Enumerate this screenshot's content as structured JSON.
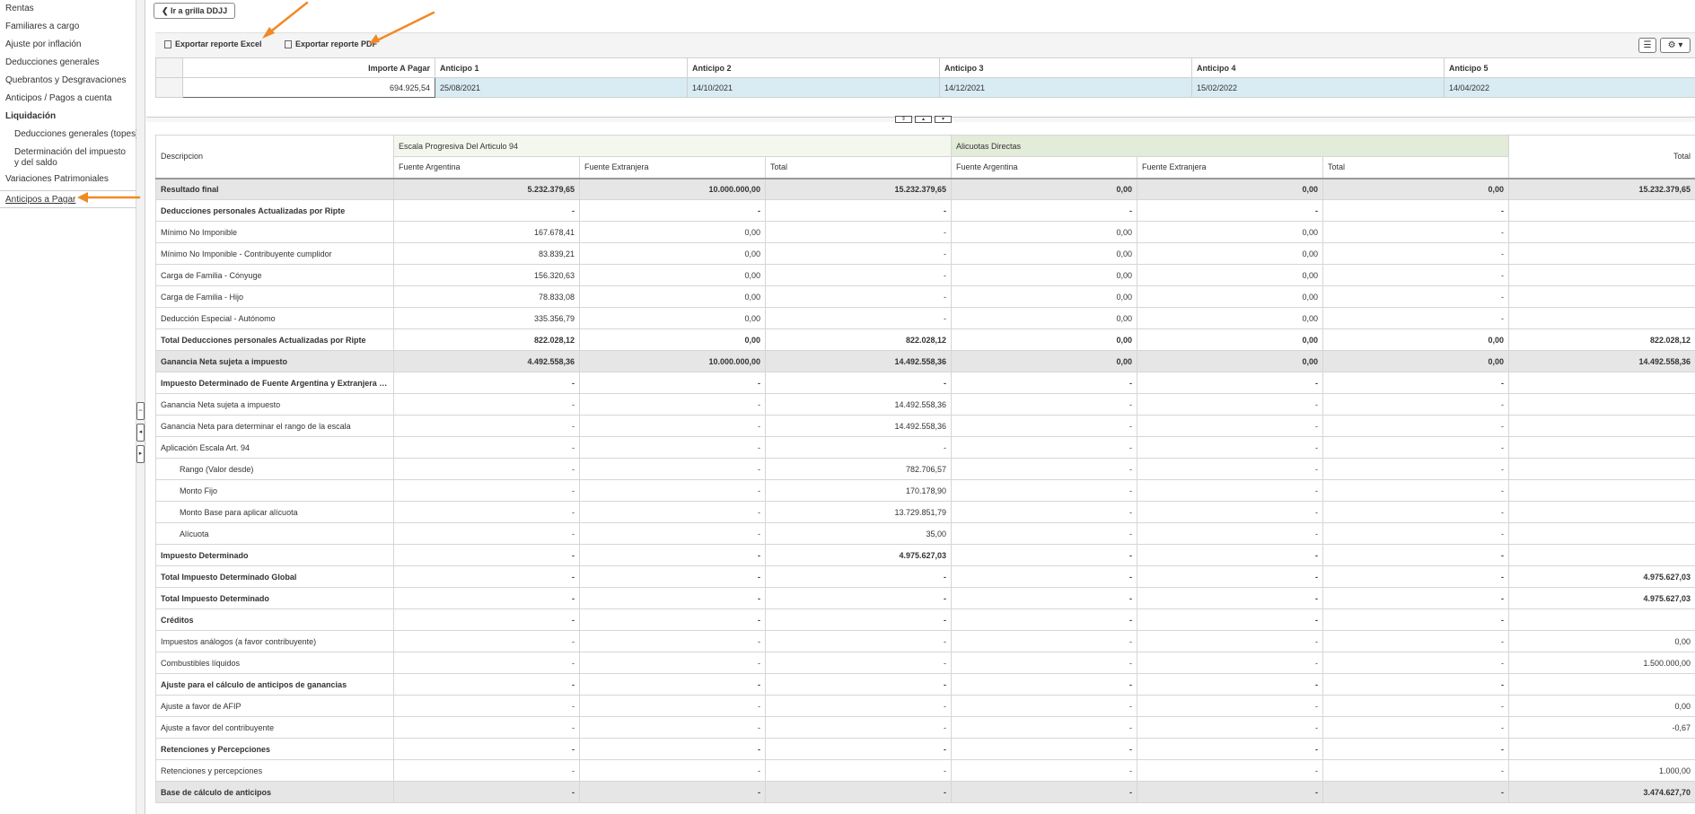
{
  "sidebar": {
    "items": [
      {
        "label": "Rentas",
        "style": ""
      },
      {
        "label": "Familiares a cargo",
        "style": ""
      },
      {
        "label": "Ajuste por inflación",
        "style": ""
      },
      {
        "label": "Deducciones generales",
        "style": ""
      },
      {
        "label": "Quebrantos y Desgravaciones",
        "style": ""
      },
      {
        "label": "Anticipos / Pagos a cuenta",
        "style": ""
      },
      {
        "label": "Liquidación",
        "style": "bold"
      },
      {
        "label": "Deducciones generales (topes)",
        "style": "sub"
      },
      {
        "label": "Determinación del impuesto y del saldo",
        "style": "sub2"
      },
      {
        "label": "Variaciones Patrimoniales",
        "style": ""
      },
      {
        "label": "Anticipos a Pagar",
        "style": "active"
      }
    ]
  },
  "splitter": {
    "buttons": [
      "⇔",
      "◂",
      "▸"
    ]
  },
  "header": {
    "back_label": "❮  Ir a grilla DDJJ"
  },
  "toolbar": {
    "excel_label": "Exportar reporte Excel",
    "pdf_label": "Exportar reporte PDF",
    "menu_icon": "☰",
    "settings_icon": "⚙ ▾"
  },
  "advances": {
    "headers": [
      "Importe A Pagar",
      "Anticipo 1",
      "Anticipo 2",
      "Anticipo 3",
      "Anticipo 4",
      "Anticipo 5"
    ],
    "values": [
      "694.925,54",
      "25/08/2021",
      "14/10/2021",
      "14/12/2021",
      "15/02/2022",
      "14/04/2022"
    ]
  },
  "mid_buttons": [
    "⇕",
    "▴",
    "▾"
  ],
  "grid": {
    "desc_header": "Descripcion",
    "group1": "Escala Progresiva Del Articulo 94",
    "group2": "Alicuotas Directas",
    "total_header": "Total",
    "subheaders": [
      "Fuente Argentina",
      "Fuente Extranjera",
      "Total",
      "Fuente Argentina",
      "Fuente Extranjera",
      "Total"
    ],
    "rows": [
      {
        "d": "Resultado final",
        "s": "bold hl top-border",
        "v": [
          "5.232.379,65",
          "10.000.000,00",
          "15.232.379,65",
          "0,00",
          "0,00",
          "0,00",
          "15.232.379,65"
        ]
      },
      {
        "d": "Deducciones personales Actualizadas por Ripte",
        "s": "bold",
        "v": [
          "-",
          "-",
          "-",
          "-",
          "-",
          "-",
          ""
        ]
      },
      {
        "d": "Mínimo No Imponible",
        "s": "",
        "v": [
          "167.678,41",
          "0,00",
          "-",
          "0,00",
          "0,00",
          "-",
          ""
        ]
      },
      {
        "d": "Mínimo No Imponible - Contribuyente cumplidor",
        "s": "",
        "v": [
          "83.839,21",
          "0,00",
          "-",
          "0,00",
          "0,00",
          "-",
          ""
        ]
      },
      {
        "d": "Carga de Familia - Cónyuge",
        "s": "",
        "v": [
          "156.320,63",
          "0,00",
          "-",
          "0,00",
          "0,00",
          "-",
          ""
        ]
      },
      {
        "d": "Carga de Familia - Hijo",
        "s": "",
        "v": [
          "78.833,08",
          "0,00",
          "-",
          "0,00",
          "0,00",
          "-",
          ""
        ]
      },
      {
        "d": "Deducción Especial - Autónomo",
        "s": "",
        "v": [
          "335.356,79",
          "0,00",
          "-",
          "0,00",
          "0,00",
          "-",
          ""
        ]
      },
      {
        "d": "Total Deducciones personales Actualizadas por Ripte",
        "s": "bold",
        "v": [
          "822.028,12",
          "0,00",
          "822.028,12",
          "0,00",
          "0,00",
          "0,00",
          "822.028,12"
        ]
      },
      {
        "d": "Ganancia Neta sujeta a impuesto",
        "s": "bold hl",
        "v": [
          "4.492.558,36",
          "10.000.000,00",
          "14.492.558,36",
          "0,00",
          "0,00",
          "0,00",
          "14.492.558,36"
        ]
      },
      {
        "d": "Impuesto Determinado de Fuente Argentina y Extranjera p...",
        "s": "bold",
        "v": [
          "-",
          "-",
          "-",
          "-",
          "-",
          "-",
          ""
        ]
      },
      {
        "d": "Ganancia Neta sujeta a impuesto",
        "s": "",
        "v": [
          "-",
          "-",
          "14.492.558,36",
          "-",
          "-",
          "-",
          ""
        ]
      },
      {
        "d": "Ganancia Neta para determinar el rango de la escala",
        "s": "",
        "v": [
          "-",
          "-",
          "14.492.558,36",
          "-",
          "-",
          "-",
          ""
        ]
      },
      {
        "d": "Aplicación Escala Art. 94",
        "s": "",
        "v": [
          "-",
          "-",
          "-",
          "-",
          "-",
          "-",
          ""
        ]
      },
      {
        "d": "Rango (Valor desde)",
        "s": "ind",
        "v": [
          "-",
          "-",
          "782.706,57",
          "-",
          "-",
          "-",
          ""
        ]
      },
      {
        "d": "Monto Fijo",
        "s": "ind",
        "v": [
          "-",
          "-",
          "170.178,90",
          "-",
          "-",
          "-",
          ""
        ]
      },
      {
        "d": "Monto Base para aplicar alícuota",
        "s": "ind",
        "v": [
          "-",
          "-",
          "13.729.851,79",
          "-",
          "-",
          "-",
          ""
        ]
      },
      {
        "d": "Alícuota",
        "s": "ind",
        "v": [
          "-",
          "-",
          "35,00",
          "-",
          "-",
          "-",
          ""
        ]
      },
      {
        "d": "Impuesto Determinado",
        "s": "bold",
        "v": [
          "-",
          "-",
          "4.975.627,03",
          "-",
          "-",
          "-",
          ""
        ]
      },
      {
        "d": "Total Impuesto Determinado Global",
        "s": "bold",
        "v": [
          "-",
          "-",
          "-",
          "-",
          "-",
          "-",
          "4.975.627,03"
        ]
      },
      {
        "d": "Total Impuesto Determinado",
        "s": "bold",
        "v": [
          "-",
          "-",
          "-",
          "-",
          "-",
          "-",
          "4.975.627,03"
        ]
      },
      {
        "d": "Créditos",
        "s": "bold",
        "v": [
          "-",
          "-",
          "-",
          "-",
          "-",
          "-",
          ""
        ]
      },
      {
        "d": "Impuestos análogos (a favor contribuyente)",
        "s": "",
        "v": [
          "-",
          "-",
          "-",
          "-",
          "-",
          "-",
          "0,00"
        ]
      },
      {
        "d": "Combustibles líquidos",
        "s": "",
        "v": [
          "-",
          "-",
          "-",
          "-",
          "-",
          "-",
          "1.500.000,00"
        ]
      },
      {
        "d": "Ajuste para el cálculo de anticipos de ganancias",
        "s": "bold",
        "v": [
          "-",
          "-",
          "-",
          "-",
          "-",
          "-",
          ""
        ]
      },
      {
        "d": "Ajuste a favor de AFIP",
        "s": "",
        "v": [
          "-",
          "-",
          "-",
          "-",
          "-",
          "-",
          "0,00"
        ]
      },
      {
        "d": "Ajuste a favor del contribuyente",
        "s": "",
        "v": [
          "-",
          "-",
          "-",
          "-",
          "-",
          "-",
          "-0,67"
        ]
      },
      {
        "d": "Retenciones y Percepciones",
        "s": "bold",
        "v": [
          "-",
          "-",
          "-",
          "-",
          "-",
          "-",
          ""
        ]
      },
      {
        "d": "Retenciones y percepciones",
        "s": "",
        "v": [
          "-",
          "-",
          "-",
          "-",
          "-",
          "-",
          "1.000,00"
        ]
      },
      {
        "d": "Base de cálculo de anticipos",
        "s": "bold hl",
        "v": [
          "-",
          "-",
          "-",
          "-",
          "-",
          "-",
          "3.474.627,70"
        ]
      }
    ]
  },
  "colors": {
    "accent_arrow": "#f08a24",
    "selected_row": "#d9ebf3",
    "highlight_row": "#e6e6e6",
    "group_header_1": "#f4f7ee",
    "group_header_2": "#e3ebd9"
  }
}
